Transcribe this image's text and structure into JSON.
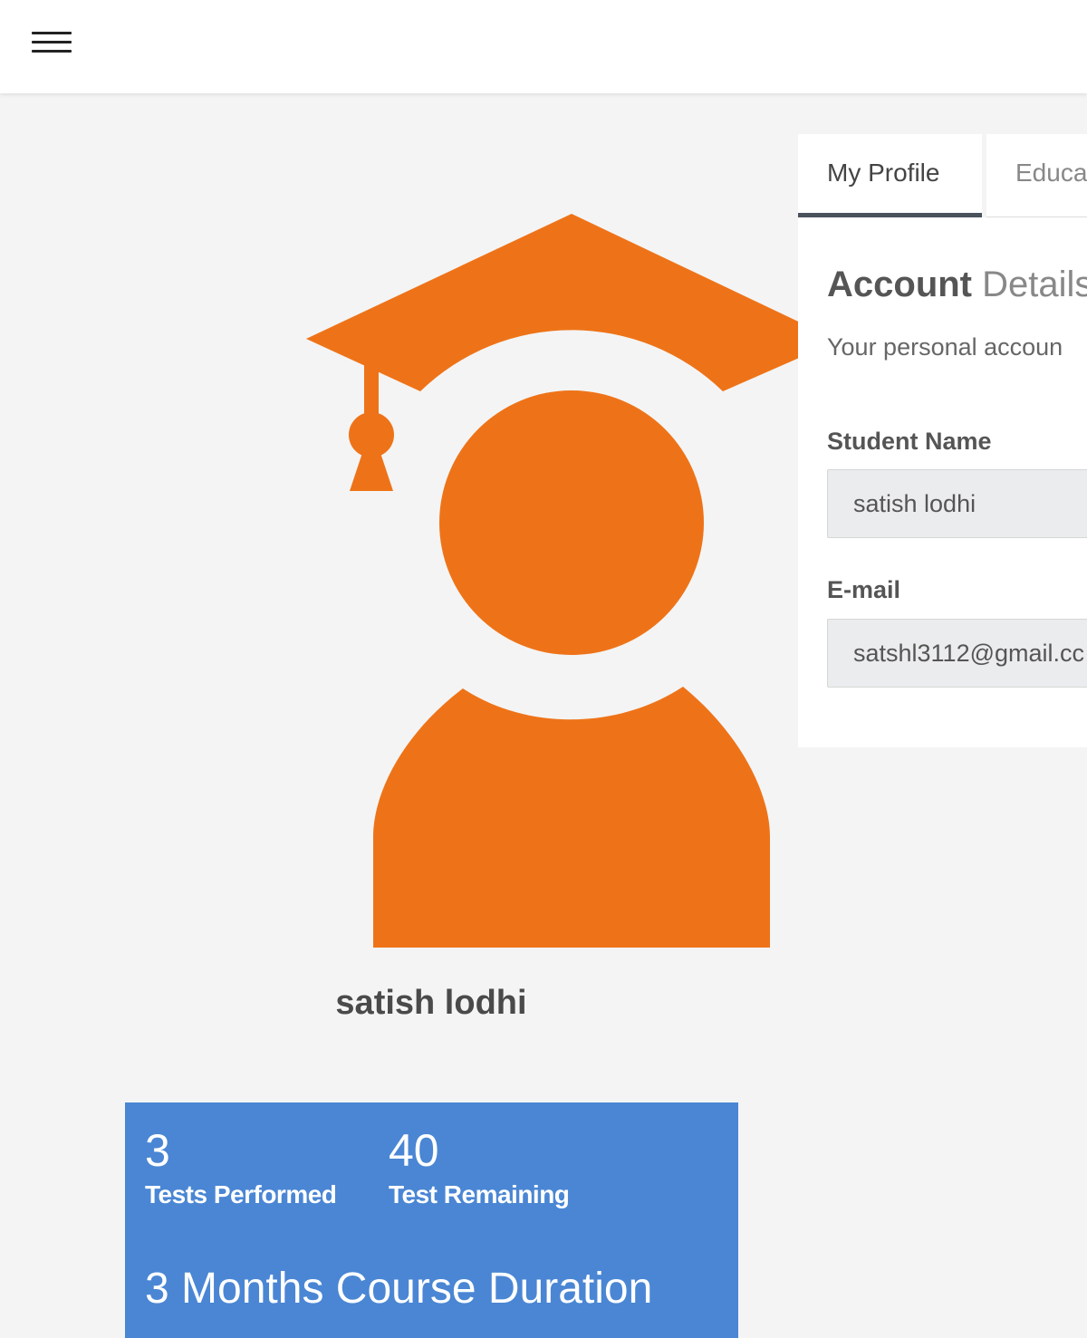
{
  "header": {
    "menu_icon": "hamburger-menu-icon"
  },
  "profile": {
    "avatar_icon": "graduate-avatar-icon",
    "avatar_color": "#ee7318",
    "student_name": "satish lodhi"
  },
  "stats": {
    "background_color": "#4a86d4",
    "tests_performed": {
      "value": "3",
      "label": "Tests Performed"
    },
    "test_remaining": {
      "value": "40",
      "label": "Test Remaining"
    },
    "course_duration": "3 Months Course Duration"
  },
  "tabs": [
    {
      "label": "My Profile",
      "active": true
    },
    {
      "label": "Educa",
      "active": false
    }
  ],
  "account": {
    "title_bold": "Account",
    "title_light": "Details",
    "subtitle": "Your personal accoun",
    "fields": [
      {
        "label": "Student Name",
        "value": "satish lodhi"
      },
      {
        "label": "E-mail",
        "value": "satshl3112@gmail.cc"
      }
    ]
  }
}
